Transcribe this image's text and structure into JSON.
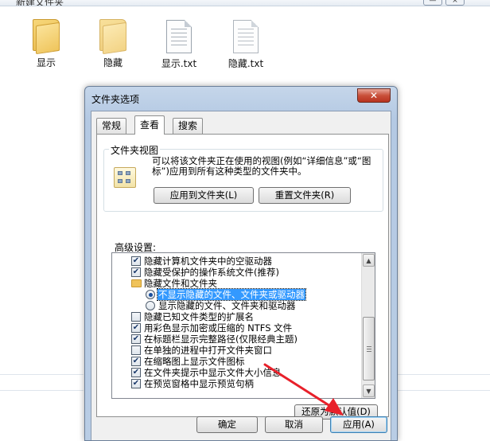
{
  "explorer": {
    "title_fragment": "新建文件夹",
    "window_buttons": [
      "—",
      "×"
    ],
    "files": [
      {
        "name": "显示",
        "type": "folder"
      },
      {
        "name": "隐藏",
        "type": "folder"
      },
      {
        "name": "显示.txt",
        "type": "text"
      },
      {
        "name": "隐藏.txt",
        "type": "text"
      }
    ]
  },
  "dialog": {
    "title": "文件夹选项",
    "close_label": "✕",
    "tabs": [
      {
        "label": "常规",
        "active": false
      },
      {
        "label": "查看",
        "active": true
      },
      {
        "label": "搜索",
        "active": false
      }
    ],
    "folder_views": {
      "group_title": "文件夹视图",
      "description": "可以将该文件夹正在使用的视图(例如“详细信息”或“图标”)应用到所有这种类型的文件夹中。",
      "apply_button": "应用到文件夹(L)",
      "reset_button": "重置文件夹(R)"
    },
    "advanced": {
      "label": "高级设置:",
      "items": [
        {
          "kind": "checkbox",
          "checked": true,
          "text": "隐藏计算机文件夹中的空驱动器",
          "indent": 1
        },
        {
          "kind": "checkbox",
          "checked": true,
          "text": "隐藏受保护的操作系统文件(推荐)",
          "indent": 1
        },
        {
          "kind": "folder",
          "text": "隐藏文件和文件夹",
          "indent": 1
        },
        {
          "kind": "radio",
          "checked": true,
          "selected": true,
          "text": "不显示隐藏的文件、文件夹或驱动器",
          "indent": 2
        },
        {
          "kind": "radio",
          "checked": false,
          "text": "显示隐藏的文件、文件夹和驱动器",
          "indent": 2
        },
        {
          "kind": "checkbox",
          "checked": false,
          "text": "隐藏已知文件类型的扩展名",
          "indent": 1
        },
        {
          "kind": "checkbox",
          "checked": true,
          "text": "用彩色显示加密或压缩的 NTFS 文件",
          "indent": 1
        },
        {
          "kind": "checkbox",
          "checked": true,
          "text": "在标题栏显示完整路径(仅限经典主题)",
          "indent": 1
        },
        {
          "kind": "checkbox",
          "checked": false,
          "text": "在单独的进程中打开文件夹窗口",
          "indent": 1
        },
        {
          "kind": "checkbox",
          "checked": true,
          "text": "在缩略图上显示文件图标",
          "indent": 1
        },
        {
          "kind": "checkbox",
          "checked": true,
          "text": "在文件夹提示中显示文件大小信息",
          "indent": 1
        },
        {
          "kind": "checkbox",
          "checked": true,
          "text": "在预览窗格中显示预览句柄",
          "indent": 1
        }
      ],
      "restore_defaults_button": "还原为默认值(D)"
    },
    "footer": {
      "ok": "确定",
      "cancel": "取消",
      "apply": "应用(A)"
    }
  },
  "colors": {
    "annotation_arrow": "#e8202a",
    "selection": "#3399ff"
  }
}
